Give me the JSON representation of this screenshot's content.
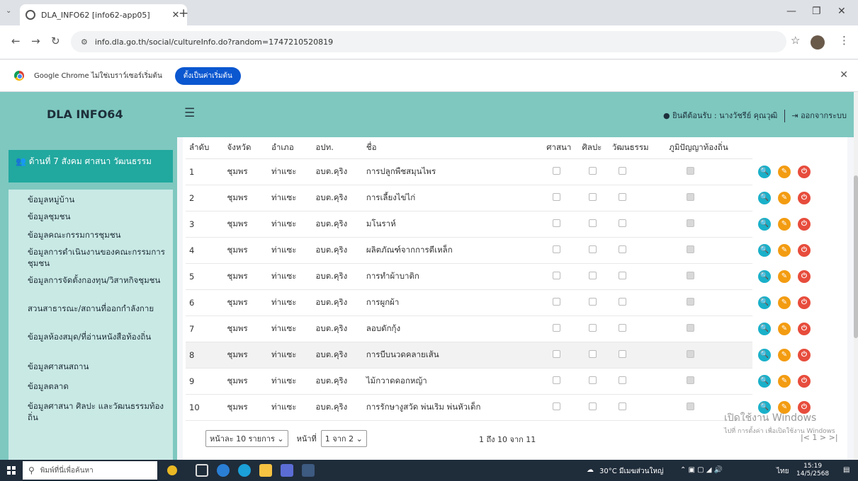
{
  "browser": {
    "tab_title": "DLA_INFO62 [info62-app05]",
    "url": "info.dla.go.th/social/cultureInfo.do?random=1747210520819"
  },
  "infobar": {
    "message": "Google Chrome ไม่ใช่เบราว์เซอร์เริ่มต้น",
    "button": "ตั้งเป็นค่าเริ่มต้น"
  },
  "app": {
    "brand": "DLA INFO64",
    "welcome": "ยินดีต้อนรับ : นางวัชรีย์ คุณวุฒิ",
    "logout": "ออกจากระบบ"
  },
  "sidebar": {
    "section": "ด้านที่ 7 สังคม ศาสนา วัฒนธรรม",
    "items": [
      "ข้อมูลหมู่บ้าน",
      "ข้อมูลชุมชน",
      "ข้อมูลคณะกรรมการชุมชน",
      "ข้อมูลการดำเนินงานของคณะกรรมการชุมชน",
      "ข้อมูลการจัดตั้งกองทุน/วิสาหกิจชุมชน",
      "สวนสาธารณะ/สถานที่ออกกำลังกาย",
      "ข้อมูลห้องสมุด/ที่อ่านหนังสือท้องถิ่น",
      "ข้อมูลศาสนสถาน",
      "ข้อมูลตลาด",
      "ข้อมูลศาสนา ศิลปะ และวัฒนธรรมท้องถิ่น"
    ]
  },
  "table": {
    "headers": [
      "ลำดับ",
      "จังหวัด",
      "อำเภอ",
      "อปท.",
      "ชื่อ",
      "ศาสนา",
      "ศิลปะ",
      "วัฒนธรรม",
      "ภูมิปัญญาท้องถิ่น"
    ],
    "rows": [
      {
        "no": "1",
        "province": "ชุมพร",
        "district": "ท่าแซะ",
        "org": "อบต.คุริง",
        "name": "การปลูกพืชสมุนไพร"
      },
      {
        "no": "2",
        "province": "ชุมพร",
        "district": "ท่าแซะ",
        "org": "อบต.คุริง",
        "name": "การเลี้ยงไข่ไก่"
      },
      {
        "no": "3",
        "province": "ชุมพร",
        "district": "ท่าแซะ",
        "org": "อบต.คุริง",
        "name": "มโนราห์"
      },
      {
        "no": "4",
        "province": "ชุมพร",
        "district": "ท่าแซะ",
        "org": "อบต.คุริง",
        "name": "ผลิตภัณฑ์จากการตีเหล็ก"
      },
      {
        "no": "5",
        "province": "ชุมพร",
        "district": "ท่าแซะ",
        "org": "อบต.คุริง",
        "name": "การทำผ้าบาติก"
      },
      {
        "no": "6",
        "province": "ชุมพร",
        "district": "ท่าแซะ",
        "org": "อบต.คุริง",
        "name": "การผูกผ้า"
      },
      {
        "no": "7",
        "province": "ชุมพร",
        "district": "ท่าแซะ",
        "org": "อบต.คุริง",
        "name": "ลอบดักกุ้ง"
      },
      {
        "no": "8",
        "province": "ชุมพร",
        "district": "ท่าแซะ",
        "org": "อบต.คุริง",
        "name": "การบีบนวดคลายเส้น"
      },
      {
        "no": "9",
        "province": "ชุมพร",
        "district": "ท่าแซะ",
        "org": "อบต.คุริง",
        "name": "ไม้กวาดดอกหญ้า"
      },
      {
        "no": "10",
        "province": "ชุมพร",
        "district": "ท่าแซะ",
        "org": "อบต.คุริง",
        "name": "การรักษางูสวัด พ่นเริม พ่นหัวเด็ก"
      }
    ]
  },
  "pager": {
    "per_page": "หน้าละ 10 รายการ",
    "page_label": "หน้าที่",
    "page_select": "1 จาก 2",
    "range_text": "1 ถึง 10 จาก 11",
    "nav": "|< 1 > >|"
  },
  "watermark": {
    "line1": "เปิดใช้งาน Windows",
    "line2": "ไปที่ การตั้งค่า เพื่อเปิดใช้งาน Windows"
  },
  "taskbar": {
    "search_placeholder": "พิมพ์ที่นี่เพื่อค้นหา",
    "weather": "30°C มีเมฆส่วนใหญ่",
    "lang": "ไทย",
    "time": "15:19",
    "date": "14/5/2568"
  }
}
